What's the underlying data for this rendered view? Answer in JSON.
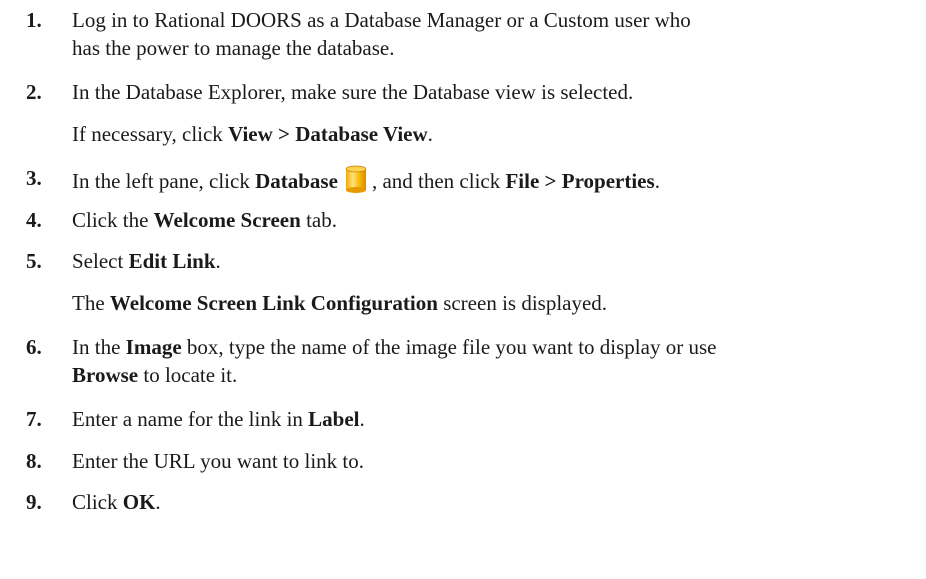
{
  "steps": [
    {
      "num": "1.",
      "line1": "Log in to Rational DOORS as a Database Manager or a Custom user who",
      "line2": "has the power to manage the database."
    },
    {
      "num": "2.",
      "text": "In the Database Explorer, make sure the Database view is selected.",
      "sub_pre": "If necessary, click ",
      "sub_bold": "View > Database View",
      "sub_post": "."
    },
    {
      "num": "3.",
      "pre": "In the left pane, click ",
      "bold1": "Database",
      "icon": "database-icon",
      "mid": ", and then click ",
      "bold2": "File > Properties",
      "post": "."
    },
    {
      "num": "4.",
      "pre": "Click the ",
      "bold": "Welcome Screen",
      "post": " tab."
    },
    {
      "num": "5.",
      "pre": "Select ",
      "bold": "Edit Link",
      "post": ".",
      "sub_pre": "The ",
      "sub_bold": "Welcome Screen Link Configuration",
      "sub_post": " screen is displayed."
    },
    {
      "num": "6.",
      "pre": "In the ",
      "bold": "Image",
      "post": " box, type the name of the image file you want to display or use",
      "line2_bold": "Browse",
      "line2_post": " to locate it."
    },
    {
      "num": "7.",
      "pre": "Enter a name for the link in ",
      "bold": "Label",
      "post": "."
    },
    {
      "num": "8.",
      "text": "Enter the URL you want to link to."
    },
    {
      "num": "9.",
      "pre": "Click ",
      "bold": "OK",
      "post": "."
    }
  ]
}
